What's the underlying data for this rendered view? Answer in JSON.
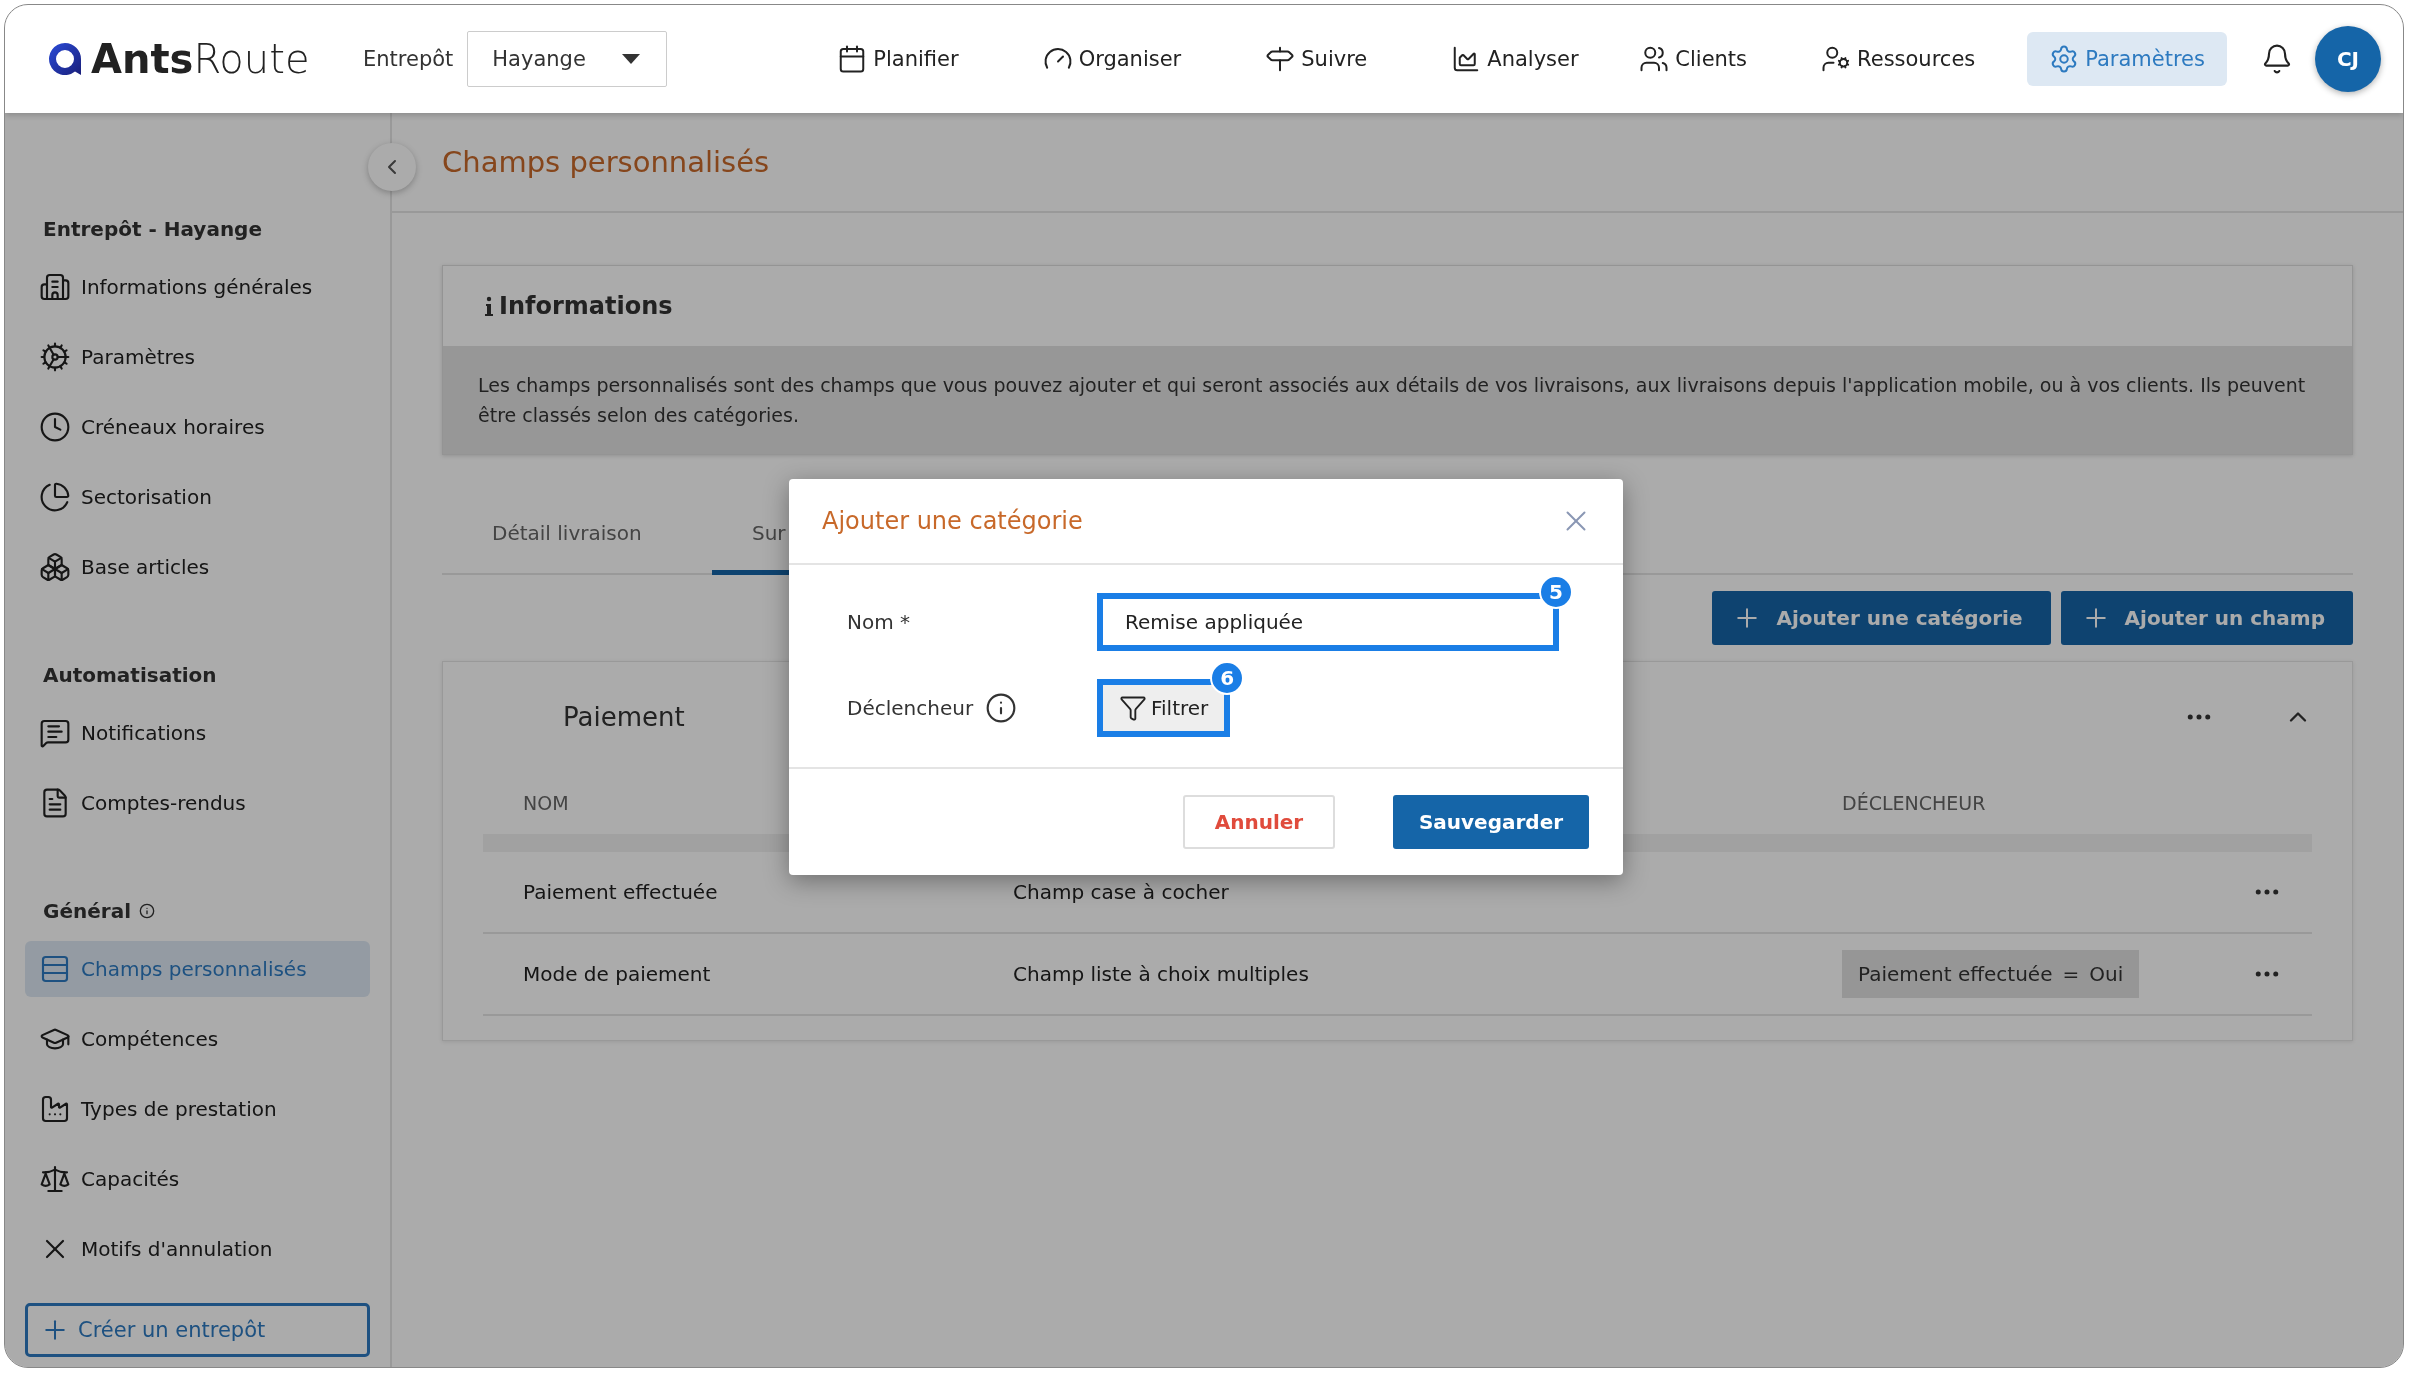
{
  "brand": {
    "bold": "Ants",
    "light": "Route"
  },
  "top_bar": {
    "warehouse_label": "Entrepôt",
    "warehouse_value": "Hayange",
    "avatar": "CJ",
    "nav": [
      {
        "label": "Planifier",
        "kind": "calendar",
        "selected": false
      },
      {
        "label": "Organiser",
        "kind": "gauge",
        "selected": false
      },
      {
        "label": "Suivre",
        "kind": "signpost",
        "selected": false
      },
      {
        "label": "Analyser",
        "kind": "chart",
        "selected": false
      },
      {
        "label": "Clients",
        "kind": "users",
        "selected": false
      },
      {
        "label": "Ressources",
        "kind": "user-cog",
        "selected": false
      },
      {
        "label": "Paramètres",
        "kind": "settings",
        "selected": true
      }
    ]
  },
  "sidebar": {
    "sections": [
      {
        "title": "Entrepôt - Hayange",
        "info": false,
        "items": [
          {
            "label": "Informations générales",
            "kind": "building",
            "selected": false
          },
          {
            "label": "Paramètres",
            "kind": "cogs",
            "selected": false
          },
          {
            "label": "Créneaux horaires",
            "kind": "clock",
            "selected": false
          },
          {
            "label": "Sectorisation",
            "kind": "pie",
            "selected": false
          },
          {
            "label": "Base articles",
            "kind": "boxes",
            "selected": false
          }
        ]
      },
      {
        "title": "Automatisation",
        "info": false,
        "items": [
          {
            "label": "Notifications",
            "kind": "message",
            "selected": false
          },
          {
            "label": "Comptes-rendus",
            "kind": "file",
            "selected": false
          }
        ]
      },
      {
        "title": "Général",
        "info": true,
        "items": [
          {
            "label": "Champs personnalisés",
            "kind": "rows",
            "selected": true
          },
          {
            "label": "Compétences",
            "kind": "cap",
            "selected": false
          },
          {
            "label": "Types de prestation",
            "kind": "factory",
            "selected": false
          },
          {
            "label": "Capacités",
            "kind": "scale",
            "selected": false
          },
          {
            "label": "Motifs d'annulation",
            "kind": "x",
            "selected": false
          }
        ]
      }
    ],
    "create_button": "Créer un entrepôt"
  },
  "page": {
    "title": "Champs personnalisés"
  },
  "info_card": {
    "title": "Informations",
    "text": "Les champs personnalisés sont des champs que vous pouvez ajouter et qui seront associés aux détails de vos livraisons, aux livraisons depuis l'application mobile, ou à vos clients. Ils peuvent être classés selon des catégories."
  },
  "tabs": [
    {
      "label": "Détail livraison",
      "selected": false
    },
    {
      "label": "Sur",
      "selected": true
    }
  ],
  "actions": [
    "Ajouter une catégorie",
    "Ajouter un champ"
  ],
  "category": {
    "name": "Paiement",
    "expanded": true,
    "columns": {
      "name": "NOM",
      "trigger": "DÉCLENCHEUR"
    },
    "rows": [
      {
        "name": "Paiement effectuée",
        "type": "Champ case à cocher"
      },
      {
        "name": "Mode de paiement",
        "type": "Champ liste à choix multiples",
        "trigger": {
          "field": "Paiement effectuée",
          "operator": "=",
          "value": "Oui"
        }
      }
    ]
  },
  "dialog": {
    "title": "Ajouter une catégorie",
    "fields": [
      {
        "kind": "text",
        "label": "Nom *",
        "value": "Remise appliquée",
        "step": "5"
      },
      {
        "kind": "filter",
        "label": "Déclencheur",
        "button": "Filtrer",
        "step": "6"
      }
    ],
    "cancel": "Annuler",
    "save": "Sauvegarder"
  }
}
